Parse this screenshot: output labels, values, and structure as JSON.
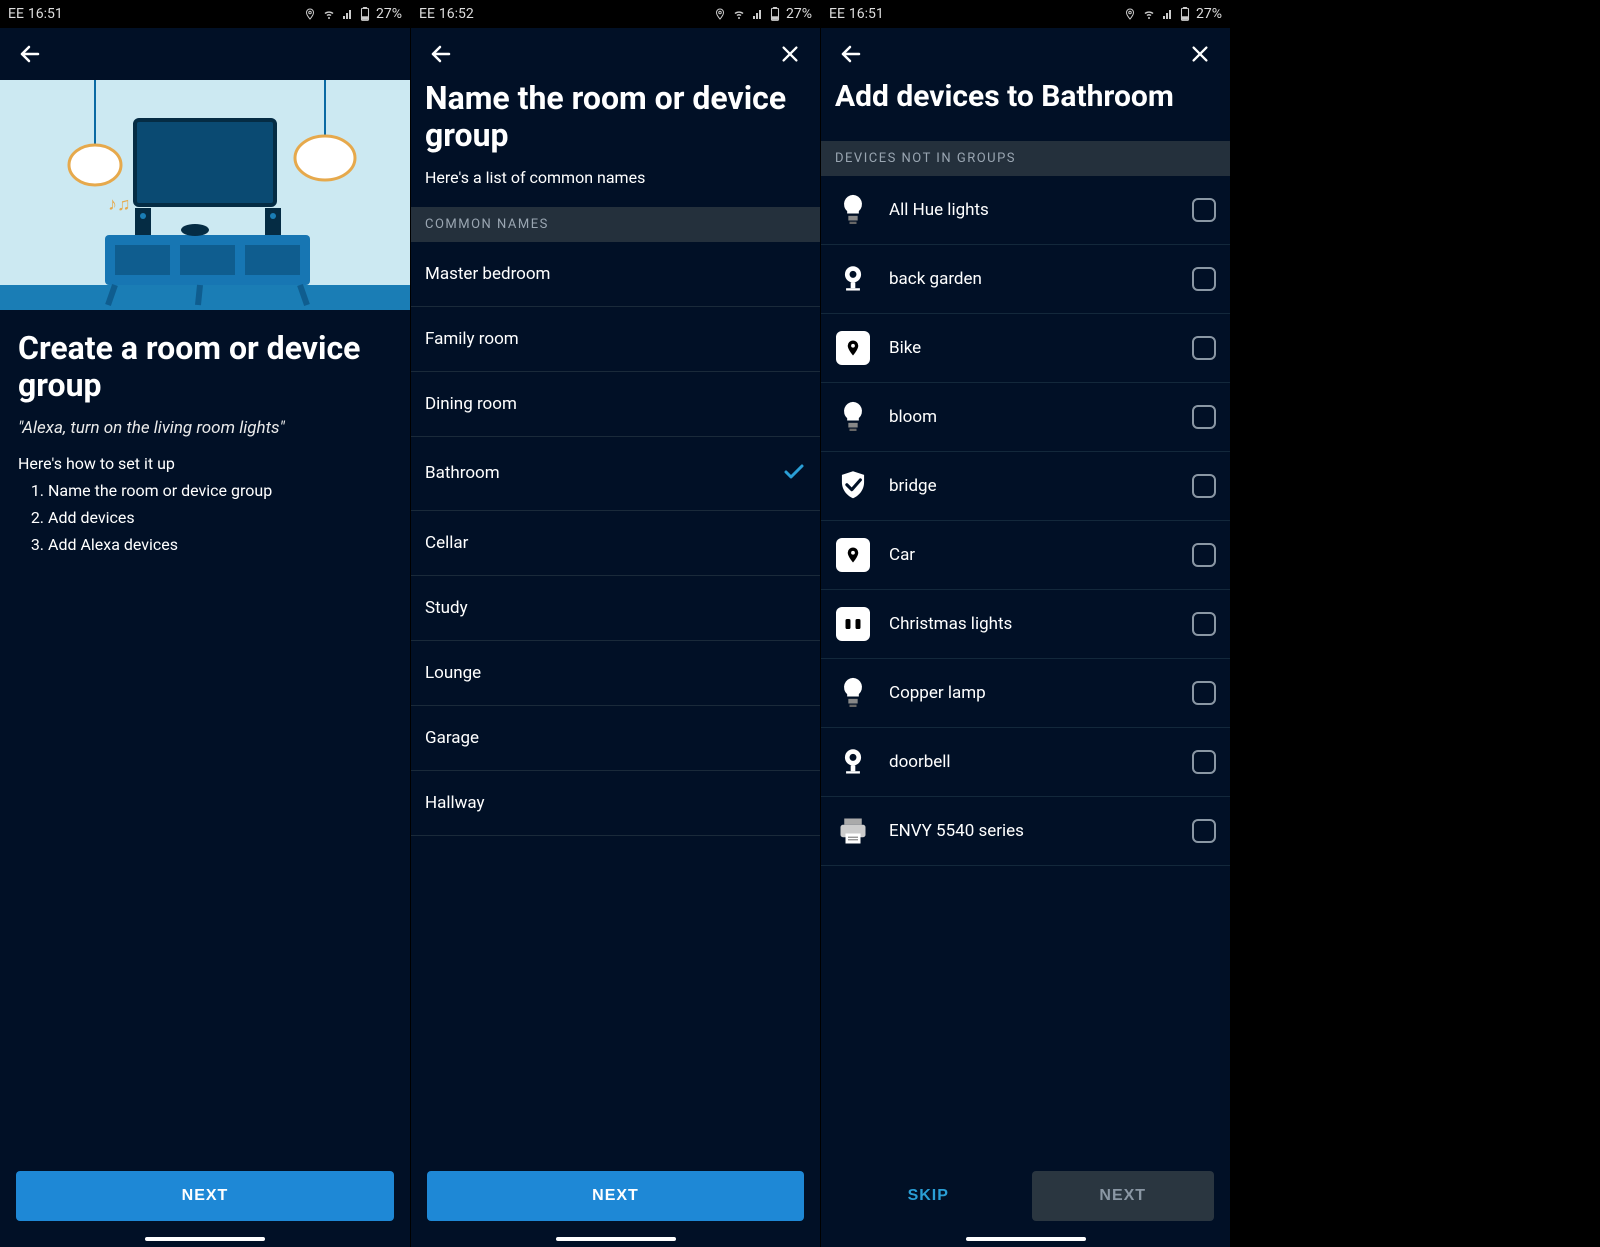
{
  "statusbar": {
    "carrier": "EE",
    "battery": "27%"
  },
  "screen1": {
    "time": "16:51",
    "title": "Create a room or device group",
    "quote": "\"Alexa, turn on the living room lights\"",
    "subtitle": "Here's how to set it up",
    "steps": [
      "Name the room or device group",
      "Add devices",
      "Add Alexa devices"
    ],
    "next": "NEXT"
  },
  "screen2": {
    "time": "16:52",
    "title": "Name the room or device group",
    "subtitle": "Here's a list of common names",
    "section": "COMMON NAMES",
    "rooms": [
      {
        "label": "Master bedroom",
        "selected": false
      },
      {
        "label": "Family room",
        "selected": false
      },
      {
        "label": "Dining room",
        "selected": false
      },
      {
        "label": "Bathroom",
        "selected": true
      },
      {
        "label": "Cellar",
        "selected": false
      },
      {
        "label": "Study",
        "selected": false
      },
      {
        "label": "Lounge",
        "selected": false
      },
      {
        "label": "Garage",
        "selected": false
      },
      {
        "label": "Hallway",
        "selected": false
      }
    ],
    "next": "NEXT"
  },
  "screen3": {
    "time": "16:51",
    "title": "Add devices to Bathroom",
    "section": "DEVICES NOT IN GROUPS",
    "devices": [
      {
        "label": "All Hue lights",
        "icon": "bulb"
      },
      {
        "label": "back garden",
        "icon": "camera"
      },
      {
        "label": "Bike",
        "icon": "tile"
      },
      {
        "label": "bloom",
        "icon": "bulb"
      },
      {
        "label": "bridge",
        "icon": "shield"
      },
      {
        "label": "Car",
        "icon": "tile"
      },
      {
        "label": "Christmas lights",
        "icon": "plug"
      },
      {
        "label": "Copper lamp",
        "icon": "bulb"
      },
      {
        "label": "doorbell",
        "icon": "camera"
      },
      {
        "label": "ENVY 5540 series",
        "icon": "printer"
      }
    ],
    "skip": "SKIP",
    "next": "NEXT"
  },
  "colors": {
    "accent": "#1e88d6",
    "bg": "#011026"
  }
}
